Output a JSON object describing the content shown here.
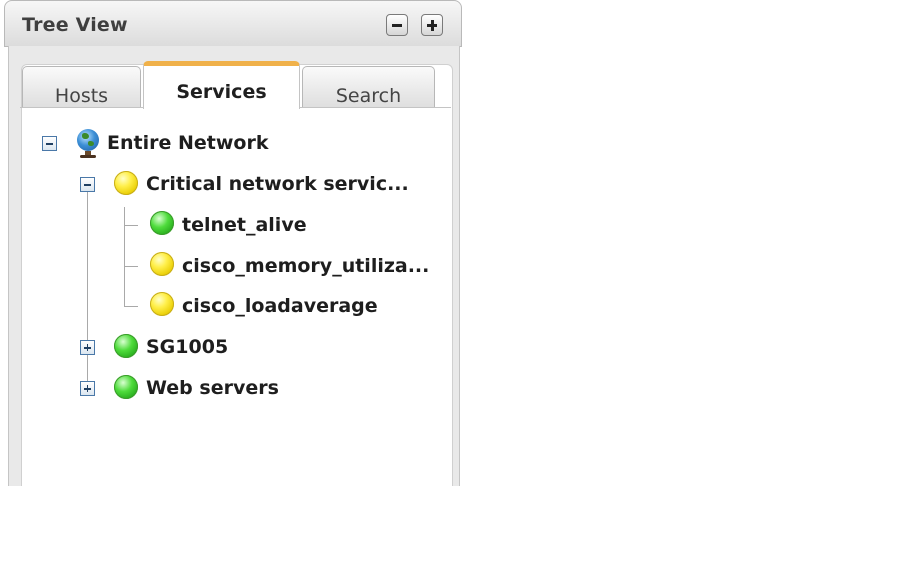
{
  "panel": {
    "title": "Tree View",
    "collapse_icon": "minus-icon",
    "expand_icon": "plus-icon"
  },
  "tabs": [
    {
      "label": "Hosts",
      "active": false
    },
    {
      "label": "Services",
      "active": true
    },
    {
      "label": "Search",
      "active": false
    }
  ],
  "tree": {
    "root": {
      "label": "Entire Network",
      "icon": "globe-icon",
      "expanded": true
    },
    "groups": [
      {
        "label": "Critical network servic...",
        "status": "yellow",
        "expanded": true,
        "children": [
          {
            "label": "telnet_alive",
            "status": "green"
          },
          {
            "label": "cisco_memory_utiliza...",
            "status": "yellow"
          },
          {
            "label": "cisco_loadaverage",
            "status": "yellow"
          }
        ]
      },
      {
        "label": "SG1005",
        "status": "green",
        "expanded": false
      },
      {
        "label": "Web servers",
        "status": "green",
        "expanded": false
      }
    ]
  },
  "colors": {
    "active_tab_accent": "#f0b14a",
    "status_yellow": "#ffef4a",
    "status_green": "#35c226"
  }
}
